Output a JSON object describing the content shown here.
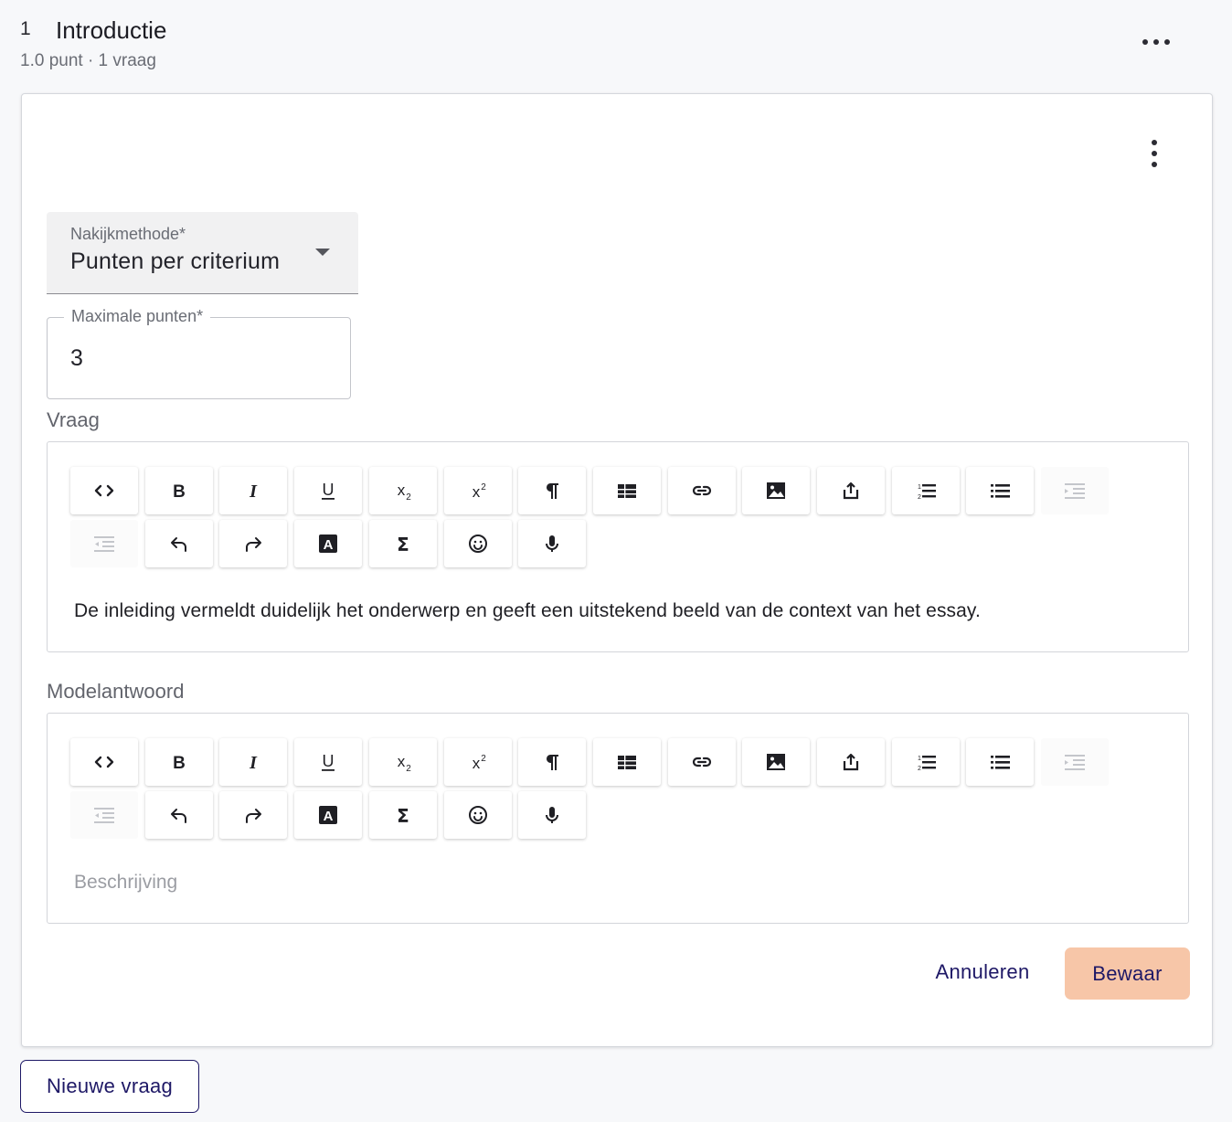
{
  "section": {
    "number": "1",
    "title": "Introductie",
    "meta": "1.0 punt · 1 vraag"
  },
  "question": {
    "grading_method": {
      "label": "Nakijkmethode*",
      "value": "Punten per criterium"
    },
    "max_points": {
      "label": "Maximale punten*",
      "value": "3"
    },
    "question_label": "Vraag",
    "question_text": "De inleiding vermeldt duidelijk het onderwerp en geeft een uitstekend beeld van de context van het essay.",
    "model_answer_label": "Modelantwoord",
    "model_answer_placeholder": "Beschrijving"
  },
  "toolbar": [
    {
      "icon": "code-icon",
      "enabled": true
    },
    {
      "icon": "bold-icon",
      "enabled": true
    },
    {
      "icon": "italic-icon",
      "enabled": true
    },
    {
      "icon": "underline-icon",
      "enabled": true
    },
    {
      "icon": "subscript-icon",
      "enabled": true
    },
    {
      "icon": "superscript-icon",
      "enabled": true
    },
    {
      "icon": "paragraph-icon",
      "enabled": true
    },
    {
      "icon": "table-icon",
      "enabled": true
    },
    {
      "icon": "link-icon",
      "enabled": true
    },
    {
      "icon": "image-icon",
      "enabled": true
    },
    {
      "icon": "upload-icon",
      "enabled": true
    },
    {
      "icon": "ordered-list-icon",
      "enabled": true
    },
    {
      "icon": "bullet-list-icon",
      "enabled": true
    },
    {
      "icon": "indent-icon",
      "enabled": false
    },
    {
      "icon": "outdent-icon",
      "enabled": false
    },
    {
      "icon": "undo-icon",
      "enabled": true
    },
    {
      "icon": "redo-icon",
      "enabled": true
    },
    {
      "icon": "text-color-icon",
      "enabled": true
    },
    {
      "icon": "math-icon",
      "enabled": true
    },
    {
      "icon": "emoji-icon",
      "enabled": true
    },
    {
      "icon": "microphone-icon",
      "enabled": true
    }
  ],
  "actions": {
    "cancel": "Annuleren",
    "save": "Bewaar",
    "new_question": "Nieuwe vraag"
  },
  "colors": {
    "primary": "#1e1866",
    "save_bg": "#f7c6a8",
    "page_bg": "#f7f8fa"
  }
}
